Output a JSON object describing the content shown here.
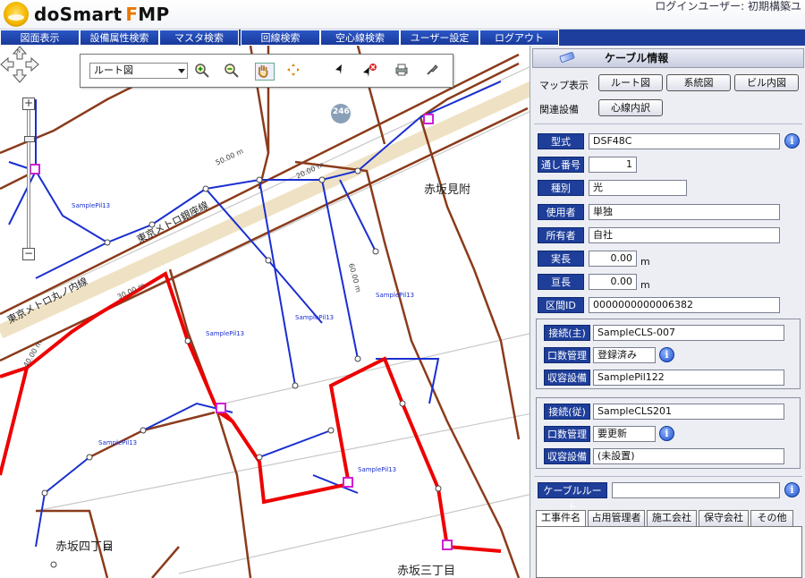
{
  "header": {
    "logo_text": "doSmart",
    "logo_fmp_f": "F",
    "logo_fmp_rest": "MP",
    "login_user": "ログインユーザー: 初期構築ユ"
  },
  "menu": [
    {
      "label": "図面表示"
    },
    {
      "label": "設備属性検索"
    },
    {
      "label": "マスタ検索"
    },
    {
      "label": "回線検索"
    },
    {
      "label": "空心線検索"
    },
    {
      "label": "ユーザー設定"
    },
    {
      "label": "ログアウト"
    }
  ],
  "map": {
    "select_value": "ルート図",
    "zoom_plus": "+",
    "zoom_minus": "−",
    "place_akasaka_mitsuke": "赤坂見附",
    "place_akasaka_4": "赤坂四丁目",
    "place_akasaka_3": "赤坂三丁目",
    "line_metro_ginza": "東京メトロ銀座線",
    "line_metro_other": "東京メトロ丸ノ内線",
    "route_badge": "246",
    "dist_40": "40.00 m",
    "dist_30": "30.00 m",
    "dist_20": "20.00 m",
    "dist_50": "50.00 m",
    "dist_60": "60.00 m",
    "sample_label": "SamplePil13"
  },
  "panel": {
    "title": "ケーブル情報",
    "map_display_label": "マップ表示",
    "btn_route": "ルート図",
    "btn_system": "系統図",
    "btn_building": "ビル内図",
    "related_label": "関連設備",
    "btn_core": "心線内訳",
    "fields": {
      "model_label": "型式",
      "model_value": "DSF48C",
      "serial_label": "通し番号",
      "serial_value": "1",
      "kind_label": "種別",
      "kind_value": "光",
      "user_label": "使用者",
      "user_value": "単独",
      "owner_label": "所有者",
      "owner_value": "自社",
      "actual_len_label": "実長",
      "actual_len_value": "0.00",
      "surplus_len_label": "亘長",
      "surplus_len_value": "0.00",
      "unit": "m",
      "section_label": "区間ID",
      "section_value": "0000000000006382"
    },
    "main_conn": {
      "conn_label": "接続(主)",
      "conn_value": "SampleCLS-007",
      "port_label": "口数管理",
      "port_value": "登録済み",
      "housing_label": "収容設備",
      "housing_value": "SamplePil122"
    },
    "sub_conn": {
      "conn_label": "接続(従)",
      "conn_value": "SampleCLS201",
      "port_label": "口数管理",
      "port_value": "要更新",
      "housing_label": "収容設備",
      "housing_value": "(未設置)"
    },
    "cable_route_label": "ケーブルルート",
    "cable_route_value": "",
    "tabs": [
      {
        "label": "工事件名"
      },
      {
        "label": "占用管理者"
      },
      {
        "label": "施工会社"
      },
      {
        "label": "保守会社"
      },
      {
        "label": "その他"
      }
    ]
  }
}
